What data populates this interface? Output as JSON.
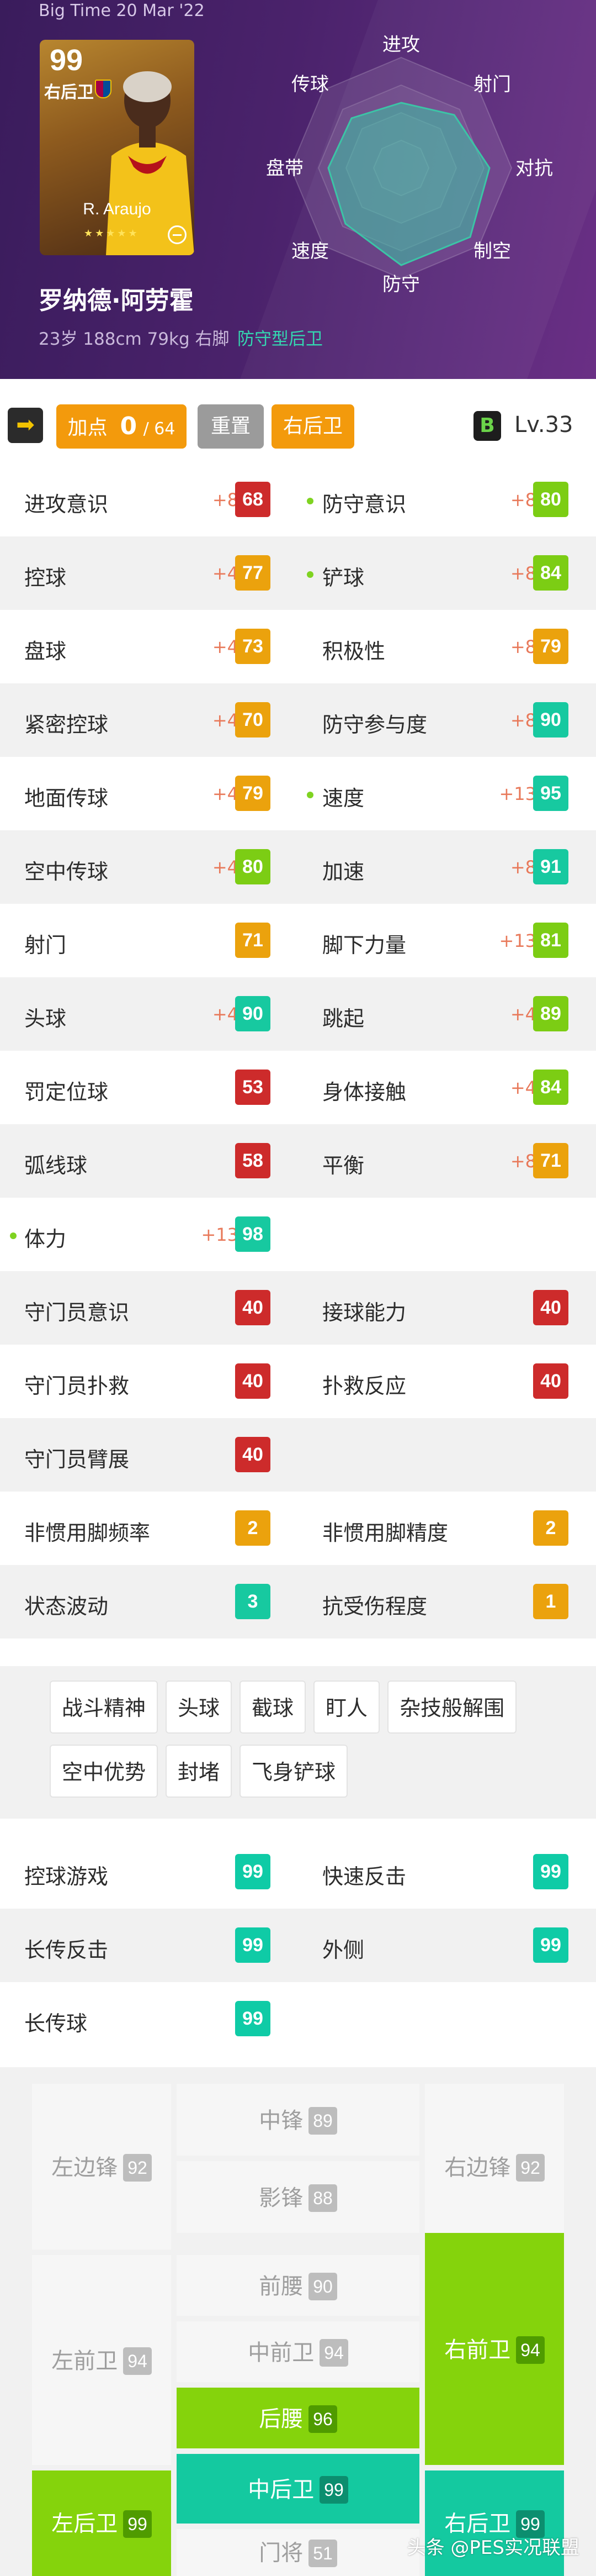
{
  "header": {
    "version": "Big Time 20 Mar '22",
    "card": {
      "rating": "99",
      "position": "右后卫",
      "name": "R. Araujo",
      "stars": "★★★★★"
    },
    "player_name": "罗纳德·阿劳霍",
    "player_info": "23岁 188cm 79kg 右脚",
    "player_role": "防守型后卫",
    "radar_labels": {
      "top": "进攻",
      "top_left": "传球",
      "top_right": "射门",
      "left": "盘带",
      "right": "对抗",
      "bottom_left": "速度",
      "bottom_right": "制空",
      "bottom": "防守"
    },
    "radar_color": "#3cc4a6"
  },
  "toolbar": {
    "add_label": "加点",
    "points_used": "0",
    "points_total": "/ 64",
    "reset_label": "重置",
    "position_label": "右后卫",
    "grade": "B",
    "level": "Lv.33"
  },
  "stats": [
    {
      "l": {
        "label": "进攻意识",
        "boost": "+8",
        "value": "68",
        "color": "red"
      },
      "r": {
        "label": "防守意识",
        "boost": "+8",
        "value": "80",
        "color": "lime",
        "dot": true
      }
    },
    {
      "l": {
        "label": "控球",
        "boost": "+4",
        "value": "77",
        "color": "orange"
      },
      "r": {
        "label": "铲球",
        "boost": "+8",
        "value": "84",
        "color": "lime",
        "dot": true
      }
    },
    {
      "l": {
        "label": "盘球",
        "boost": "+4",
        "value": "73",
        "color": "orange"
      },
      "r": {
        "label": "积极性",
        "boost": "+8",
        "value": "79",
        "color": "orange"
      }
    },
    {
      "l": {
        "label": "紧密控球",
        "boost": "+4",
        "value": "70",
        "color": "orange"
      },
      "r": {
        "label": "防守参与度",
        "boost": "+8",
        "value": "90",
        "color": "teal"
      }
    },
    {
      "l": {
        "label": "地面传球",
        "boost": "+4",
        "value": "79",
        "color": "orange"
      },
      "r": {
        "label": "速度",
        "boost": "+13",
        "value": "95",
        "color": "teal",
        "dot": true
      }
    },
    {
      "l": {
        "label": "空中传球",
        "boost": "+4",
        "value": "80",
        "color": "lime"
      },
      "r": {
        "label": "加速",
        "boost": "+8",
        "value": "91",
        "color": "teal"
      }
    },
    {
      "l": {
        "label": "射门",
        "boost": "",
        "value": "71",
        "color": "orange"
      },
      "r": {
        "label": "脚下力量",
        "boost": "+13",
        "value": "81",
        "color": "lime"
      }
    },
    {
      "l": {
        "label": "头球",
        "boost": "+4",
        "value": "90",
        "color": "teal"
      },
      "r": {
        "label": "跳起",
        "boost": "+4",
        "value": "89",
        "color": "lime"
      }
    },
    {
      "l": {
        "label": "罚定位球",
        "boost": "",
        "value": "53",
        "color": "red"
      },
      "r": {
        "label": "身体接触",
        "boost": "+4",
        "value": "84",
        "color": "lime"
      }
    },
    {
      "l": {
        "label": "弧线球",
        "boost": "",
        "value": "58",
        "color": "red"
      },
      "r": {
        "label": "平衡",
        "boost": "+8",
        "value": "71",
        "color": "orange"
      }
    },
    {
      "l": {
        "label": "体力",
        "boost": "+13",
        "value": "98",
        "color": "teal",
        "dot": true
      },
      "r": null
    },
    {
      "l": {
        "label": "守门员意识",
        "boost": "",
        "value": "40",
        "color": "red"
      },
      "r": {
        "label": "接球能力",
        "boost": "",
        "value": "40",
        "color": "red"
      }
    },
    {
      "l": {
        "label": "守门员扑救",
        "boost": "",
        "value": "40",
        "color": "red"
      },
      "r": {
        "label": "扑救反应",
        "boost": "",
        "value": "40",
        "color": "red"
      }
    },
    {
      "l": {
        "label": "守门员臂展",
        "boost": "",
        "value": "40",
        "color": "red"
      },
      "r": null
    },
    {
      "l": {
        "label": "非惯用脚频率",
        "boost": "",
        "value": "2",
        "color": "orange"
      },
      "r": {
        "label": "非惯用脚精度",
        "boost": "",
        "value": "2",
        "color": "orange"
      }
    },
    {
      "l": {
        "label": "状态波动",
        "boost": "",
        "value": "3",
        "color": "teal"
      },
      "r": {
        "label": "抗受伤程度",
        "boost": "",
        "value": "1",
        "color": "orange"
      }
    }
  ],
  "skills": [
    "战斗精神",
    "头球",
    "截球",
    "盯人",
    "杂技般解围",
    "空中优势",
    "封堵",
    "飞身铲球"
  ],
  "playstyles": [
    {
      "l": {
        "label": "控球游戏",
        "value": "99"
      },
      "r": {
        "label": "快速反击",
        "value": "99"
      }
    },
    {
      "l": {
        "label": "长传反击",
        "value": "99"
      },
      "r": {
        "label": "外侧",
        "value": "99"
      }
    },
    {
      "l": {
        "label": "长传球",
        "value": "99"
      },
      "r": null
    }
  ],
  "positions": {
    "lwf": {
      "label": "左边锋",
      "value": "92"
    },
    "cf": {
      "label": "中锋",
      "value": "89"
    },
    "ss": {
      "label": "影锋",
      "value": "88"
    },
    "rwf": {
      "label": "右边锋",
      "value": "92"
    },
    "lmf": {
      "label": "左前卫",
      "value": "94"
    },
    "amf": {
      "label": "前腰",
      "value": "90"
    },
    "cmf": {
      "label": "中前卫",
      "value": "94"
    },
    "dmf": {
      "label": "后腰",
      "value": "96"
    },
    "rmf": {
      "label": "右前卫",
      "value": "94"
    },
    "lb": {
      "label": "左后卫",
      "value": "99"
    },
    "cb": {
      "label": "中后卫",
      "value": "99"
    },
    "gk": {
      "label": "门将",
      "value": "51"
    },
    "rb": {
      "label": "右后卫",
      "value": "99"
    }
  },
  "watermark": "头条 @PES实况联盟",
  "colors": {
    "red": "#cd2b2b",
    "orange": "#eba20d",
    "lime": "#7ccd14",
    "teal": "#17c9a0",
    "accent_orange": "#f39a0c"
  }
}
